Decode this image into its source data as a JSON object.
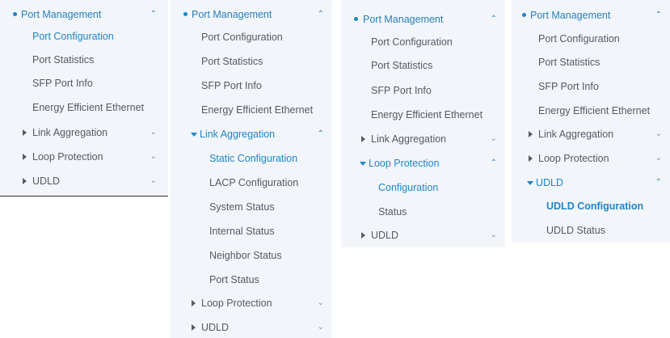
{
  "panel1": {
    "header": "Port Management",
    "items": [
      "Port Configuration",
      "Port Statistics",
      "SFP Port Info",
      "Energy Efficient Ethernet"
    ],
    "groups": [
      "Link Aggregation",
      "Loop Protection",
      "UDLD"
    ]
  },
  "panel2": {
    "header": "Port Management",
    "items": [
      "Port Configuration",
      "Port Statistics",
      "SFP Port Info",
      "Energy Efficient Ethernet"
    ],
    "expanded_group": "Link Aggregation",
    "sub_items": [
      "Static Configuration",
      "LACP Configuration",
      "System Status",
      "Internal Status",
      "Neighbor Status",
      "Port Status"
    ],
    "groups": [
      "Loop Protection",
      "UDLD"
    ]
  },
  "panel3": {
    "header": "Port Management",
    "items": [
      "Port Configuration",
      "Port Statistics",
      "SFP Port Info",
      "Energy Efficient Ethernet"
    ],
    "group_before": "Link Aggregation",
    "expanded_group": "Loop Protection",
    "sub_items": [
      "Configuration",
      "Status"
    ],
    "group_after": "UDLD"
  },
  "panel4": {
    "header": "Port Management",
    "items": [
      "Port Configuration",
      "Port Statistics",
      "SFP Port Info",
      "Energy Efficient Ethernet"
    ],
    "groups": [
      "Link Aggregation",
      "Loop Protection"
    ],
    "expanded_group": "UDLD",
    "sub_items": [
      "UDLD Configuration",
      "UDLD Status"
    ]
  },
  "icons": {
    "bullet": "dot-icon",
    "collapsed": "caret-right-icon",
    "expanded": "caret-down-icon",
    "chevron_down": "chevron-down-icon",
    "chevron_up": "chevron-up-icon"
  },
  "colors": {
    "background": "#f2f5f9",
    "text": "#555b63",
    "accent": "#1f86c8"
  }
}
